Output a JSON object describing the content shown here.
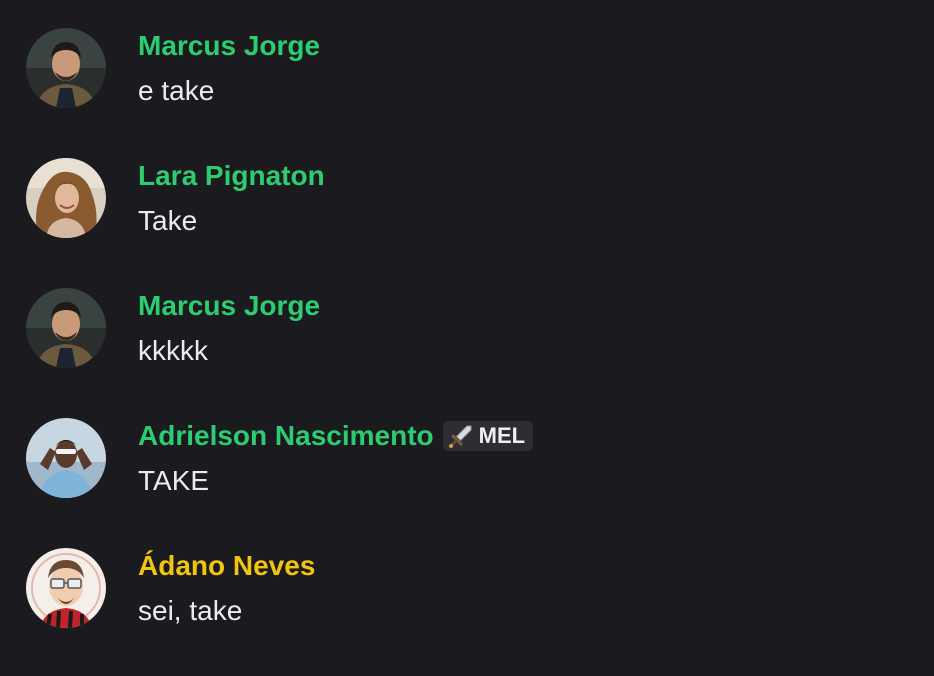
{
  "colors": {
    "background": "#1b1b1f",
    "name_green": "#2ecc71",
    "name_gold": "#f1c40f",
    "message_text": "#ececee"
  },
  "messages": [
    {
      "author": "Marcus Jorge",
      "text": "e take",
      "name_color": "#2ecc71",
      "avatar": "man-dark-hair-avatar"
    },
    {
      "author": "Lara Pignaton",
      "text": "Take",
      "name_color": "#2ecc71",
      "avatar": "woman-curly-hair-avatar"
    },
    {
      "author": "Marcus Jorge",
      "text": "kkkkk",
      "name_color": "#2ecc71",
      "avatar": "man-dark-hair-avatar"
    },
    {
      "author": "Adrielson Nascimento",
      "text": "TAKE",
      "name_color": "#2ecc71",
      "avatar": "man-sky-background-avatar",
      "tag": {
        "icon": "sword-icon",
        "label": "MEL"
      }
    },
    {
      "author": "Ádano Neves",
      "text": "sei, take",
      "name_color": "#f1c40f",
      "avatar": "cartoon-man-glasses-avatar"
    }
  ]
}
